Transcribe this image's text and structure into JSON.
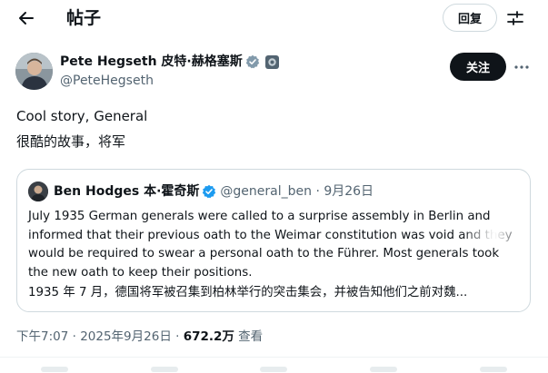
{
  "header": {
    "title": "帖子",
    "reply_label": "回复"
  },
  "author": {
    "name": "Pete Hegseth 皮特·赫格塞斯",
    "handle": "@PeteHegseth",
    "follow_label": "关注"
  },
  "post": {
    "text_en": "Cool story, General",
    "text_zh": "很酷的故事，将军"
  },
  "quote": {
    "name": "Ben Hodges 本·霍奇斯",
    "handle": "@general_ben · 9月26日",
    "text_en": "July 1935 German generals were called to a surprise assembly in Berlin and informed that their previous oath to the Weimar constitution was void and they would be required to swear a personal oath to the Führer. Most generals took the new oath to keep their positions.",
    "text_zh": "1935 年 7 月，德国将军被召集到柏林举行的突击集会，并被告知他们之前对魏..."
  },
  "meta": {
    "time": "下午7:07 · 2025年9月26日 · ",
    "views": "672.2万",
    "views_label": " 查看"
  },
  "colors": {
    "accent": "#1d9bf0",
    "text": "#0f1419",
    "secondary": "#536471"
  },
  "icons": [
    "back-arrow-icon",
    "settings-icon",
    "verified-icon",
    "affiliate-badge-icon",
    "more-icon"
  ]
}
